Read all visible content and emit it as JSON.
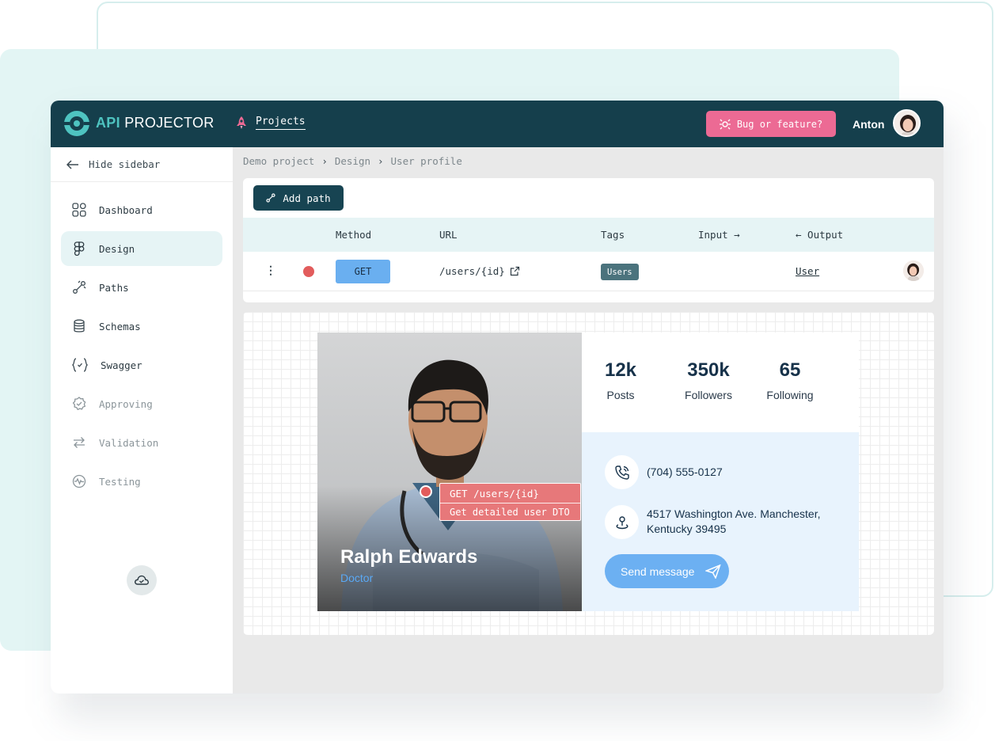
{
  "app": {
    "brand_prefix": "API",
    "brand_suffix": "PROJECTOR",
    "nav_projects": "Projects",
    "bug_button": "Bug or feature?",
    "user_name": "Anton"
  },
  "sidebar": {
    "hide_label": "Hide sidebar",
    "items": [
      {
        "label": "Dashboard",
        "icon": "grid-icon",
        "state": "normal"
      },
      {
        "label": "Design",
        "icon": "figma-icon",
        "state": "active"
      },
      {
        "label": "Paths",
        "icon": "paths-icon",
        "state": "normal"
      },
      {
        "label": "Schemas",
        "icon": "database-icon",
        "state": "normal"
      },
      {
        "label": "Swagger",
        "icon": "braces-icon",
        "state": "normal"
      },
      {
        "label": "Approving",
        "icon": "badge-check-icon",
        "state": "muted"
      },
      {
        "label": "Validation",
        "icon": "arrows-swap-icon",
        "state": "muted"
      },
      {
        "label": "Testing",
        "icon": "pulse-icon",
        "state": "muted"
      }
    ]
  },
  "breadcrumb": [
    "Demo project",
    "Design",
    "User profile"
  ],
  "breadcrumb_separator": "›",
  "paths": {
    "add_path_label": "Add path",
    "columns": {
      "method": "Method",
      "url": "URL",
      "tags": "Tags",
      "input": "Input →",
      "output": "← Output"
    },
    "rows": [
      {
        "method": "GET",
        "url": "/users/{id}",
        "tag": "Users",
        "output": "User",
        "status_color": "#e25c5c"
      }
    ]
  },
  "preview": {
    "name": "Ralph Edwards",
    "role": "Doctor",
    "annotation": {
      "endpoint": "GET /users/{id}",
      "description": "Get detailed user DTO"
    },
    "stats": [
      {
        "value": "12k",
        "label": "Posts"
      },
      {
        "value": "350k",
        "label": "Followers"
      },
      {
        "value": "65",
        "label": "Following"
      }
    ],
    "phone": "(704) 555-0127",
    "address_line1": "4517 Washington Ave. Manchester,",
    "address_line2": "Kentucky 39495",
    "send_label": "Send message"
  },
  "colors": {
    "topbar": "#153f4c",
    "accent_teal": "#4ec3c0",
    "bug_button": "#ec6a94",
    "method_get": "#6aaff0",
    "status_red": "#e25c5c",
    "send_button": "#6cb0f2"
  }
}
